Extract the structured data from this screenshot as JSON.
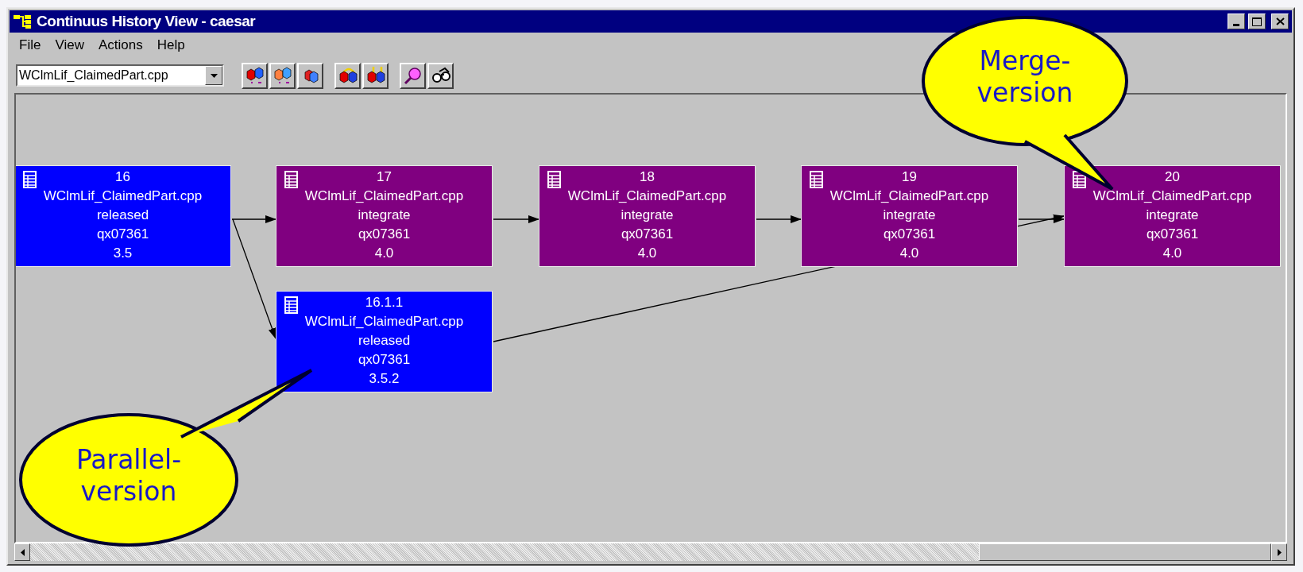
{
  "window": {
    "title": "Continuus History View - caesar"
  },
  "menu": [
    "File",
    "View",
    "Actions",
    "Help"
  ],
  "toolbar": {
    "file_select": {
      "value": "WClmLif_ClaimedPart.cpp"
    }
  },
  "nodes": [
    {
      "number": "16",
      "file": "WClmLif_ClaimedPart.cpp",
      "status": "released",
      "owner": "qx07361",
      "version": "3.5",
      "color": "#0000ff"
    },
    {
      "number": "17",
      "file": "WClmLif_ClaimedPart.cpp",
      "status": "integrate",
      "owner": "qx07361",
      "version": "4.0",
      "color": "#800080"
    },
    {
      "number": "18",
      "file": "WClmLif_ClaimedPart.cpp",
      "status": "integrate",
      "owner": "qx07361",
      "version": "4.0",
      "color": "#800080"
    },
    {
      "number": "19",
      "file": "WClmLif_ClaimedPart.cpp",
      "status": "integrate",
      "owner": "qx07361",
      "version": "4.0",
      "color": "#800080"
    },
    {
      "number": "20",
      "file": "WClmLif_ClaimedPart.cpp",
      "status": "integrate",
      "owner": "qx07361",
      "version": "4.0",
      "color": "#800080"
    },
    {
      "number": "16.1.1",
      "file": "WClmLif_ClaimedPart.cpp",
      "status": "released",
      "owner": "qx07361",
      "version": "3.5.2",
      "color": "#0000ff"
    }
  ],
  "callouts": [
    {
      "lines": [
        "Merge-",
        "version"
      ]
    },
    {
      "lines": [
        "Parallel-",
        "version"
      ]
    }
  ]
}
